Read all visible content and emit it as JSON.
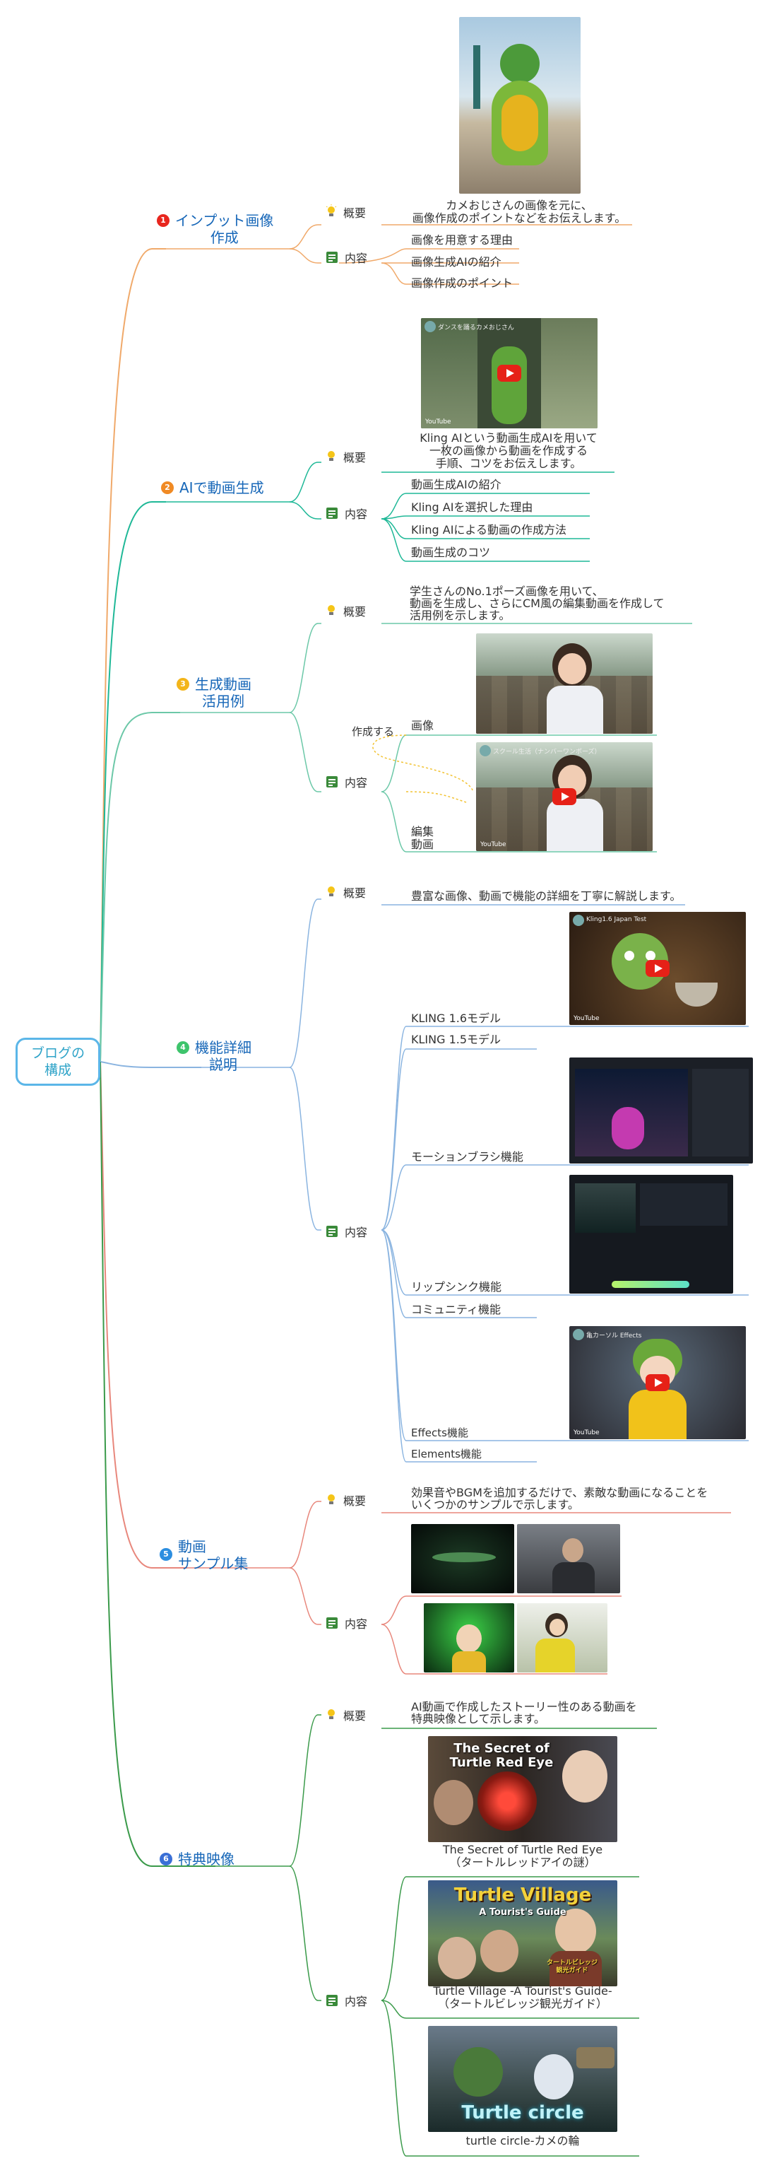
{
  "root": {
    "title": "ブログの\n構成"
  },
  "colors": {
    "b1": "#f0a96a",
    "b2": "#1fb897",
    "b3": "#6cc8a8",
    "b4": "#8ab4e0",
    "b5": "#e8877c",
    "b6": "#3a9a4a",
    "title_blue": "#1767b8"
  },
  "branches": [
    {
      "num": "1",
      "title": "インプット画像\n作成",
      "color": "#e8261e"
    },
    {
      "num": "2",
      "title": "AIで動画生成",
      "color": "#f08a24"
    },
    {
      "num": "3",
      "title": "生成動画\n活用例",
      "color": "#f3b51a"
    },
    {
      "num": "4",
      "title": "機能詳細\n説明",
      "color": "#3ec46c"
    },
    {
      "num": "5",
      "title": "動画\nサンプル集",
      "color": "#2c8ee0"
    },
    {
      "num": "6",
      "title": "特典映像",
      "color": "#3a6fd6"
    }
  ],
  "labels": {
    "overview": "概要",
    "content": "内容"
  },
  "b1": {
    "overview": "カメおじさんの画像を元に、\n画像作成のポイントなどをお伝えします。",
    "items": [
      "画像を用意する理由",
      "画像生成AIの紹介",
      "画像作成のポイント"
    ]
  },
  "b2": {
    "video_title": "ダンスを踊るカメおじさん",
    "overview": "Kling AIという動画生成AIを用いて\n一枚の画像から動画を作成する\n手順、コツをお伝えします。",
    "items": [
      "動画生成AIの紹介",
      "Kling AIを選択した理由",
      "Kling AIによる動画の作成方法",
      "動画生成のコツ"
    ]
  },
  "b3": {
    "overview": "学生さんのNo.1ポーズ画像を用いて、\n動画を生成し、さらにCM風の編集動画を作成して\n活用例を示します。",
    "make": "作成する",
    "items": [
      "画像",
      "編集\n動画"
    ],
    "video_title": "スクール生活（ナンバーワンポーズ）"
  },
  "b4": {
    "overview": "豊富な画像、動画で機能の詳細を丁寧に解説します。",
    "items": [
      "KLING 1.6モデル",
      "KLING 1.5モデル",
      "モーションブラシ機能",
      "リップシンク機能",
      "コミュニティ機能",
      "Effects機能",
      "Elements機能"
    ],
    "video1_title": "Kling1.6 Japan Test",
    "video2_title": "亀カーソル Effects"
  },
  "b5": {
    "overview": "効果音やBGMを追加するだけで、素敵な動画になることを\nいくつかのサンプルで示します。"
  },
  "b6": {
    "overview": "AI動画で作成したストーリー性のある動画を\n特典映像として示します。",
    "videos": [
      {
        "caption": "The Secret of Turtle Red Eye\n（タートルレッドアイの謎）",
        "thumb": "The Secret of\nTurtle Red Eye"
      },
      {
        "caption": "Turtle Village -A Tourist's Guide-\n（タートルビレッジ観光ガイド）",
        "thumb": "Turtle Village",
        "thumb_sub": "A Tourist's Guide",
        "thumb_jp": "タートルビレッジ\n観光ガイド"
      },
      {
        "caption": "turtle circle-カメの輪",
        "thumb": "Turtle circle"
      }
    ]
  },
  "youtube": "YouTube"
}
